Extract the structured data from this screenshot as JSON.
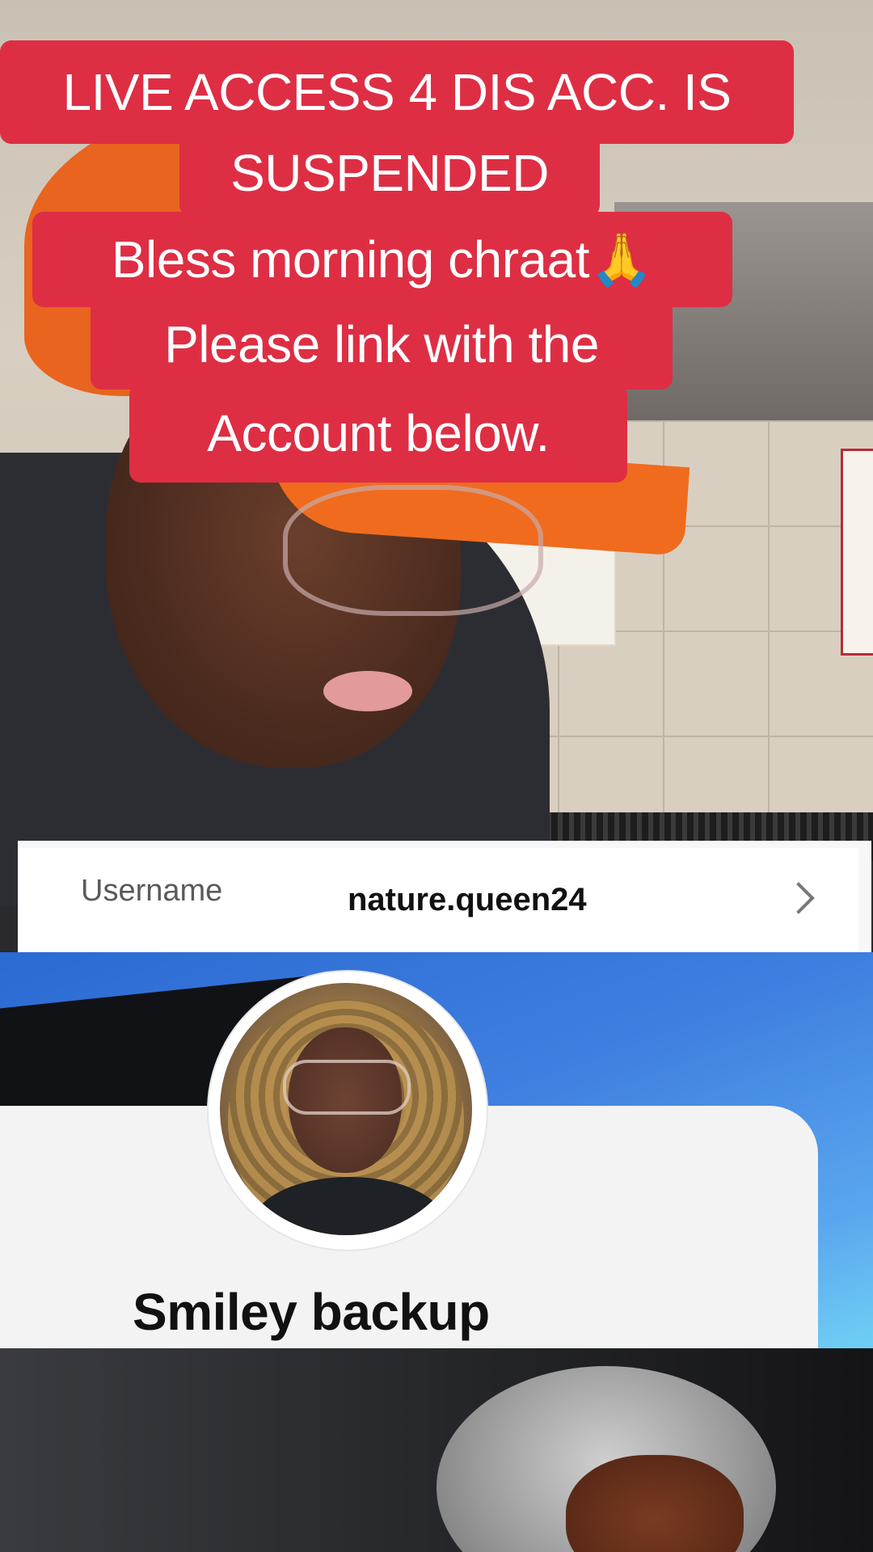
{
  "caption": {
    "line1": "LIVE ACCESS 4 DIS ACC. IS",
    "line2": "SUSPENDED",
    "line3": "Bless morning chraat🙏",
    "line4": "Please link with the",
    "line5": "Account below."
  },
  "username_row": {
    "label": "Username",
    "value": "nature.queen24",
    "icon": "chevron-right-icon"
  },
  "profile": {
    "display_name": "Smiley backup"
  },
  "colors": {
    "caption_bg": "#de2e44",
    "caption_text": "#ffffff",
    "profile_blue": "#3f7fe0"
  }
}
